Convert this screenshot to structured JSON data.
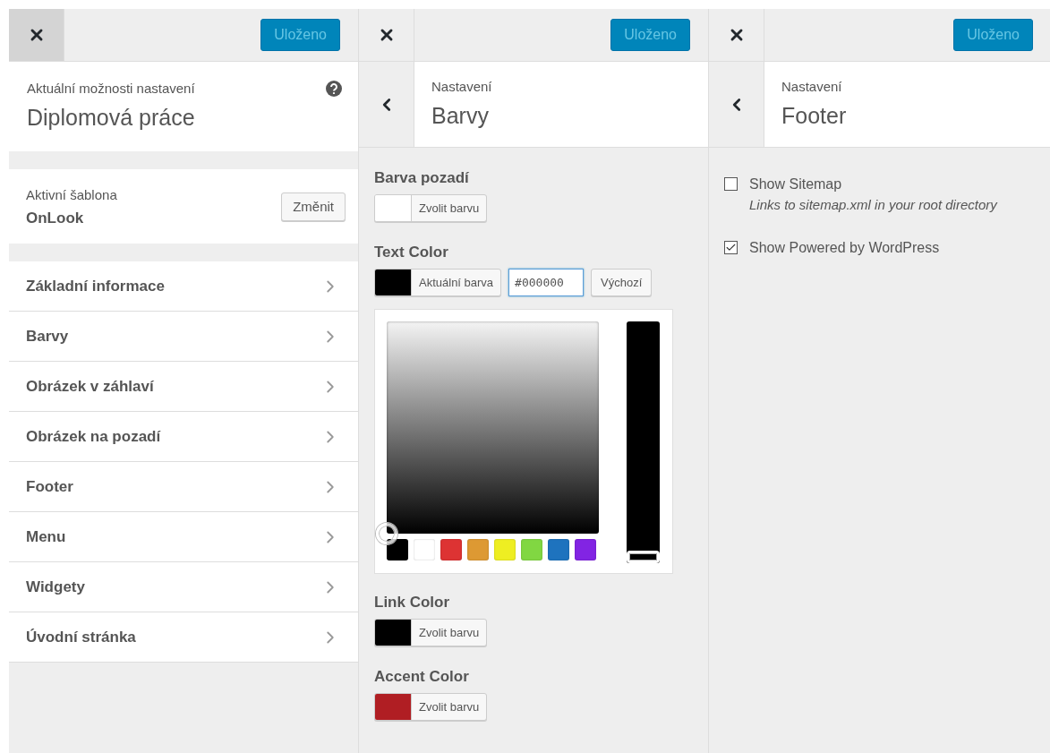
{
  "panels": [
    {
      "kind": "main",
      "close_pressed": true,
      "save": "Uloženo",
      "heading": {
        "caption": "Aktuální možnosti nastavení",
        "title": "Diplomová práce"
      },
      "theme": {
        "caption": "Aktivní šablona",
        "name": "OnLook",
        "button": "Změnit"
      },
      "items": [
        "Základní informace",
        "Barvy",
        "Obrázek v záhlaví",
        "Obrázek na pozadí",
        "Footer",
        "Menu",
        "Widgety",
        "Úvodní stránka"
      ]
    },
    {
      "kind": "colors",
      "close_pressed": false,
      "save": "Uloženo",
      "heading": {
        "caption": "Nastavení",
        "title": "Barvy"
      },
      "controls": [
        {
          "label": "Barva pozadí",
          "color": "#ffffff",
          "button": "Zvolit barvu",
          "expanded": false
        },
        {
          "label": "Text Color",
          "color": "#000000",
          "button": "Aktuální barva",
          "expanded": true,
          "value": "#000000",
          "default_button": "Výchozí",
          "picker": {
            "swatches": [
              {
                "color": "#000000"
              },
              {
                "color": "#ffffff"
              },
              {
                "color": "#dd3333"
              },
              {
                "color": "#dd9933"
              },
              {
                "color": "#eeee22"
              },
              {
                "color": "#81d742"
              },
              {
                "color": "#1e73be"
              },
              {
                "color": "#8224e3"
              }
            ],
            "slider": {
              "level": 0
            }
          }
        },
        {
          "label": "Link Color",
          "color": "#000000",
          "button": "Zvolit barvu",
          "expanded": false
        },
        {
          "label": "Accent Color",
          "color": "#b01e23",
          "button": "Zvolit barvu",
          "expanded": false
        }
      ]
    },
    {
      "kind": "options",
      "close_pressed": false,
      "save": "Uloženo",
      "heading": {
        "caption": "Nastavení",
        "title": "Footer"
      },
      "options": [
        {
          "label": "Show Sitemap",
          "description": "Links to sitemap.xml in your root directory",
          "checked": false
        },
        {
          "label": "Show Powered by WordPress",
          "checked": true
        }
      ]
    }
  ]
}
